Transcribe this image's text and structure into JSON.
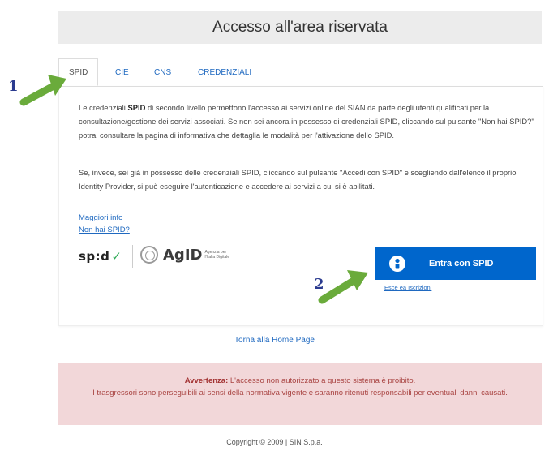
{
  "header": {
    "title": "Accesso all'area riservata"
  },
  "tabs": [
    {
      "label": "SPID",
      "active": true
    },
    {
      "label": "CIE",
      "active": false
    },
    {
      "label": "CNS",
      "active": false
    },
    {
      "label": "CREDENZIALI",
      "active": false
    }
  ],
  "panel": {
    "para1_pre": "Le credenziali ",
    "para1_bold": "SPID",
    "para1_post": " di secondo livello permettono l'accesso ai servizi online del SIAN da parte degli utenti qualificati per la consultazione/gestione dei servizi associati. Se non sei ancora in possesso di credenziali SPID, cliccando sul pulsante \"Non hai SPID?\" potrai consultare la pagina di informativa che dettaglia le modalità per l'attivazione dello SPID.",
    "para2": "Se, invece, sei già in possesso delle credenziali SPID, cliccando sul pulsante \"Accedi con SPID\" e scegliendo dall'elenco il proprio Identity Provider, si può eseguire l'autenticazione e accedere ai servizi a cui si è abilitati.",
    "link_more_info": "Maggiori info",
    "link_no_spid": "Non hai SPID?",
    "spid_logo_text": "sp:d",
    "agid_logo_text": "AgID",
    "agid_subtitle": "Agenzia per l'Italia Digitale",
    "spid_button_label": "Entra con SPID",
    "spid_small_link": "Esce ea Iscrizioni"
  },
  "home_link": "Torna alla Home Page",
  "warning": {
    "bold": "Avvertenza:",
    "line1": " L'accesso non autorizzato a questo sistema è proibito.",
    "line2": "I trasgressori sono perseguibili ai sensi della normativa vigente e saranno ritenuti responsabili per eventuali danni causati."
  },
  "copyright": "Copyright © 2009 | SIN S.p.a.",
  "annotations": [
    {
      "number": "1"
    },
    {
      "number": "2"
    }
  ],
  "colors": {
    "link": "#1f69c0",
    "spid_button": "#0066cc",
    "warning_bg": "#f2d7d9",
    "warning_text": "#a94442",
    "arrow": "#6aab3b",
    "annotation_number": "#2a3a8f"
  }
}
